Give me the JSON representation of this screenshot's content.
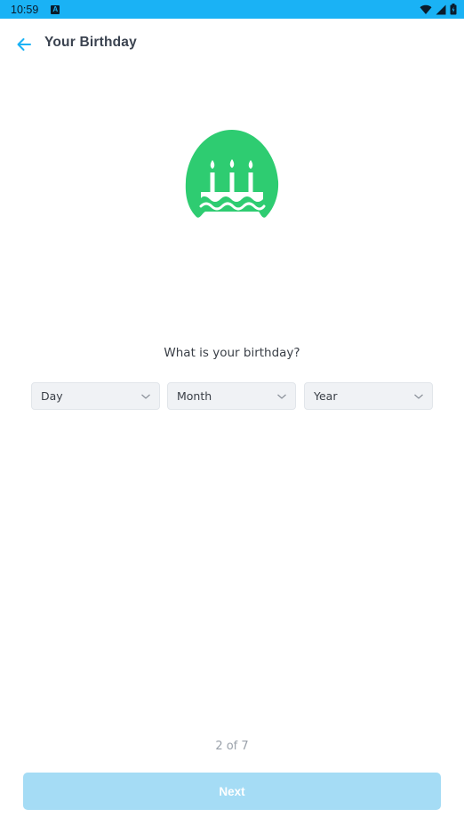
{
  "status_bar": {
    "time": "10:59",
    "notification_icon": "a-badge-icon",
    "icons": [
      "wifi-icon",
      "signal-icon",
      "battery-icon"
    ],
    "background_color": "#1ab2f5"
  },
  "app_bar": {
    "back_icon": "arrow-left-icon",
    "title": "Your Birthday"
  },
  "illustration": {
    "icon": "birthday-cake-icon",
    "color": "#2ecc71"
  },
  "form": {
    "question": "What is your birthday?",
    "day_select": {
      "value": "Day",
      "icon": "chevron-down-icon"
    },
    "month_select": {
      "value": "Month",
      "icon": "chevron-down-icon"
    },
    "year_select": {
      "value": "Year",
      "icon": "chevron-down-icon"
    }
  },
  "progress": {
    "text": "2 of 7"
  },
  "footer": {
    "next_label": "Next",
    "next_enabled": false,
    "accent_color": "#a5dcf5"
  }
}
